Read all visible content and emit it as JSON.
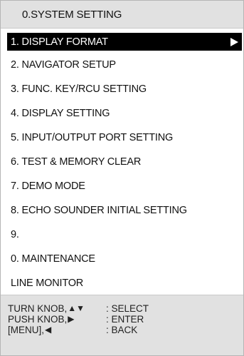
{
  "title": "0.SYSTEM SETTING",
  "menu": {
    "items": [
      {
        "label": "1. DISPLAY FORMAT"
      },
      {
        "label": "2. NAVIGATOR SETUP"
      },
      {
        "label": "3. FUNC. KEY/RCU SETTING"
      },
      {
        "label": "4. DISPLAY SETTING"
      },
      {
        "label": "5. INPUT/OUTPUT PORT SETTING"
      },
      {
        "label": "6. TEST & MEMORY CLEAR"
      },
      {
        "label": "7. DEMO MODE"
      },
      {
        "label": "8. ECHO SOUNDER INITIAL SETTING"
      },
      {
        "label": "9."
      },
      {
        "label": "0. MAINTENANCE"
      },
      {
        "label": "LINE MONITOR"
      }
    ]
  },
  "help": {
    "line1": {
      "prefix": "TURN KNOB,",
      "glyph": "▲▼",
      "action": ": SELECT"
    },
    "line2": {
      "prefix": "PUSH KNOB,",
      "glyph": "▶",
      "action": ": ENTER"
    },
    "line3": {
      "prefix": "[MENU],",
      "glyph": "◀",
      "action": ": BACK"
    }
  },
  "icons": {
    "selected_arrow": "triangle-right-icon"
  }
}
